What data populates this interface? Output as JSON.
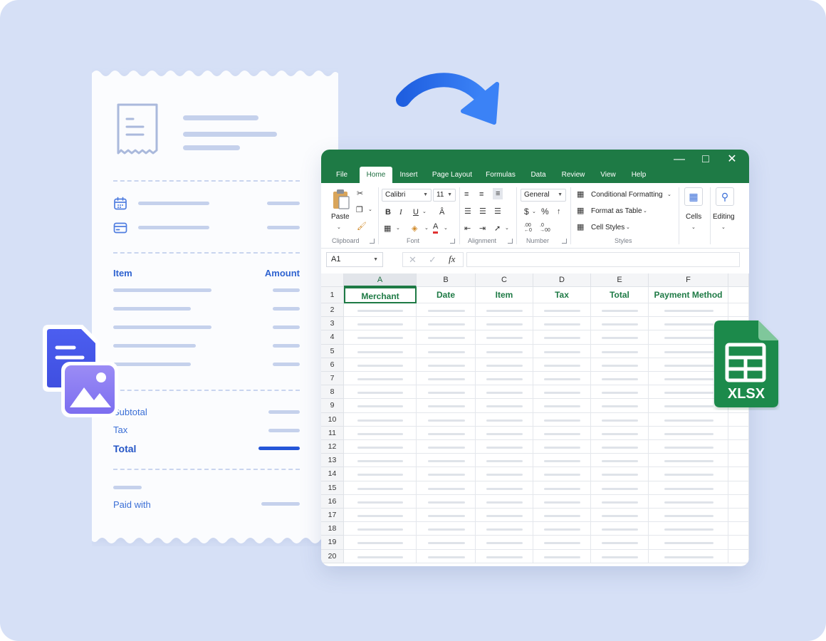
{
  "receipt": {
    "item_label": "Item",
    "amount_label": "Amount",
    "subtotal_label": "Subtotal",
    "tax_label": "Tax",
    "total_label": "Total",
    "paid_with_label": "Paid with"
  },
  "excel": {
    "tabs": [
      "File",
      "Home",
      "Insert",
      "Page Layout",
      "Formulas",
      "Data",
      "Review",
      "View",
      "Help"
    ],
    "active_tab": "Home",
    "ribbon": {
      "paste_label": "Paste",
      "font_name": "Calibri",
      "font_size": "11",
      "number_format": "General",
      "conditional_formatting": "Conditional Formatting",
      "format_as_table": "Format as Table",
      "cell_styles": "Cell Styles",
      "cells_label": "Cells",
      "editing_label": "Editing",
      "groups": {
        "clipboard": "Clipboard",
        "font": "Font",
        "alignment": "Alignment",
        "number": "Number",
        "styles": "Styles"
      }
    },
    "name_box": "A1",
    "fx_label": "fx",
    "columns": [
      "A",
      "B",
      "C",
      "D",
      "E",
      "F"
    ],
    "headers": [
      "Merchant",
      "Date",
      "Item",
      "Tax",
      "Total",
      "Payment Method"
    ],
    "rows": [
      "1",
      "2",
      "3",
      "4",
      "5",
      "6",
      "7",
      "8",
      "9",
      "10",
      "11",
      "12",
      "13",
      "14",
      "15",
      "16",
      "17",
      "18",
      "19",
      "20"
    ]
  },
  "xlsx_badge": {
    "label": "XLSX"
  },
  "colors": {
    "background": "#d6e0f6",
    "excel_green": "#1e7a45",
    "arrow_blue": "#2563eb",
    "receipt_blue": "#3b6fd6"
  }
}
